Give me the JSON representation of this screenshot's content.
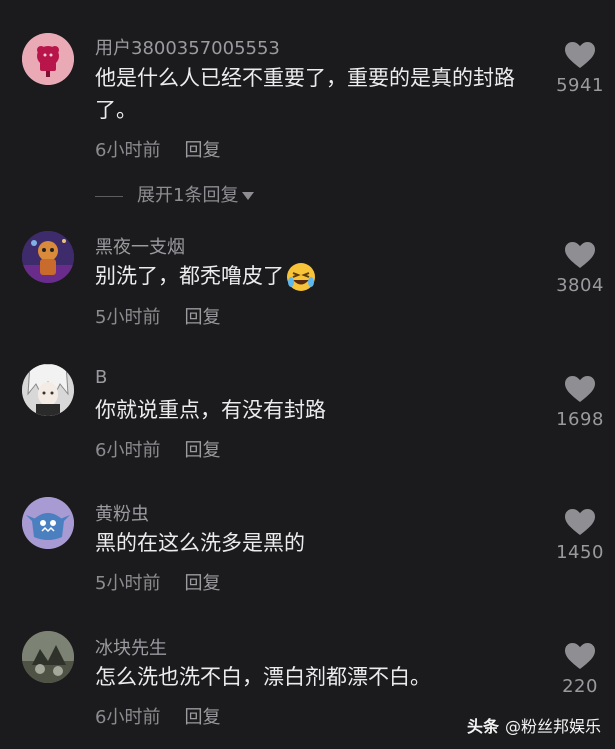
{
  "comments": [
    {
      "username": "用户3800357005553",
      "text": "他是什么人已经不重要了，重要的是真的封路了。",
      "time": "6小时前",
      "reply": "回复",
      "likes": "5941",
      "avatar": "flower-avatar"
    },
    {
      "username": "黑夜一支烟",
      "text": "别洗了，都秃噜皮了",
      "emoji": "🤣",
      "time": "5小时前",
      "reply": "回复",
      "likes": "3804",
      "avatar": "character-avatar"
    },
    {
      "username": "B",
      "text": "你就说重点，有没有封路",
      "time": "6小时前",
      "reply": "回复",
      "likes": "1698",
      "avatar": "anime-avatar"
    },
    {
      "username": "黄粉虫",
      "text": "黑的在这么洗多是黑的",
      "time": "5小时前",
      "reply": "回复",
      "likes": "1450",
      "avatar": "monster-avatar"
    },
    {
      "username": "冰块先生",
      "text": "怎么洗也洗不白，漂白剂都漂不白。",
      "time": "6小时前",
      "reply": "回复",
      "likes": "220",
      "avatar": "photo-avatar"
    }
  ],
  "expand_replies": "展开1条回复",
  "watermark": {
    "brand": "头条",
    "handle": "@粉丝邦娱乐"
  }
}
